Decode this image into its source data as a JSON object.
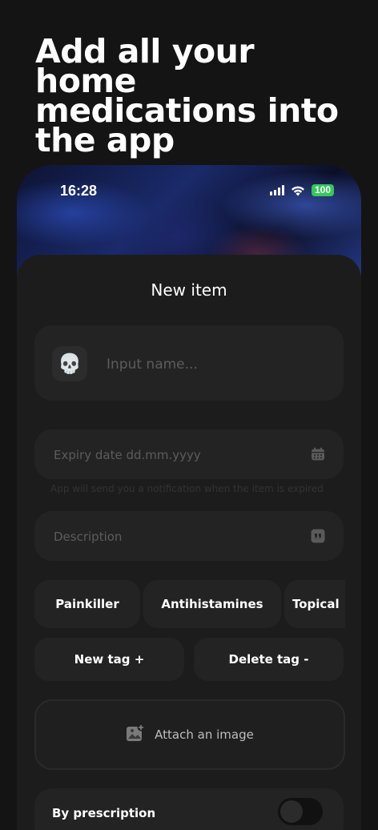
{
  "headline": "Add all your home medications into the app",
  "status_bar": {
    "time": "16:28",
    "battery": "100"
  },
  "sheet": {
    "title": "New item",
    "name_field": {
      "avatar_emoji": "💀",
      "placeholder": "Input name..."
    },
    "expiry_field": {
      "placeholder": "Expiry date dd.mm.yyyy",
      "icon": "calendar-icon"
    },
    "expiry_hint": "App will send you a notification when the item is expired",
    "description_field": {
      "placeholder": "Description",
      "icon": "quote-icon"
    },
    "tags": [
      "Painkiller",
      "Antihistamines",
      "Topical"
    ],
    "new_tag_label": "New tag +",
    "delete_tag_label": "Delete tag -",
    "attach_label": "Attach an image",
    "prescription_label": "By prescription",
    "prescription_on": false
  },
  "colors": {
    "background": "#141414",
    "card": "#232323",
    "battery": "#34c759"
  }
}
